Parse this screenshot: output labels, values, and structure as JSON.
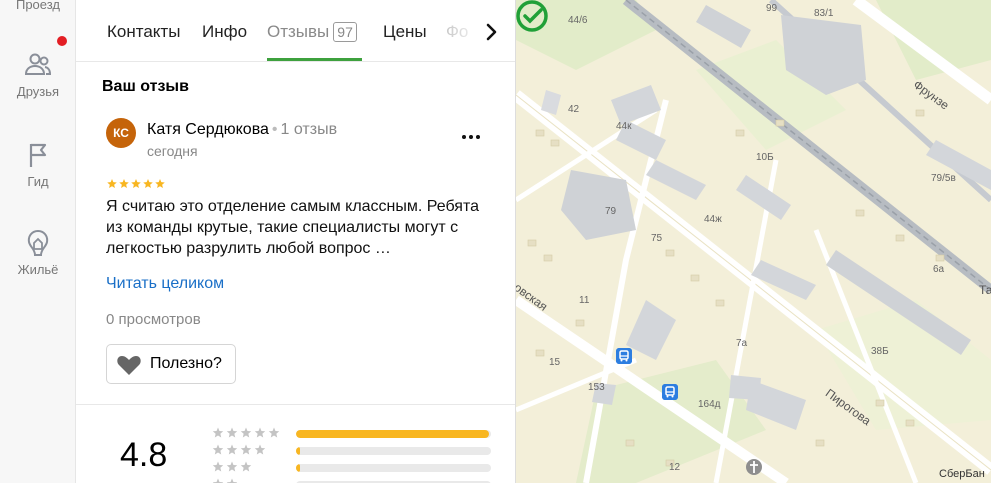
{
  "rail": {
    "items": [
      {
        "label": "Проезд",
        "icon": "route-icon"
      },
      {
        "label": "Друзья",
        "icon": "friends-icon",
        "has_notification": true
      },
      {
        "label": "Гид",
        "icon": "flag-icon"
      },
      {
        "label": "Жильё",
        "icon": "house-icon"
      }
    ]
  },
  "tabs": {
    "items": [
      {
        "label": "Контакты"
      },
      {
        "label": "Инфо"
      },
      {
        "label": "Отзывы",
        "count": "97",
        "active": true
      },
      {
        "label": "Цены"
      },
      {
        "label": "Фо"
      }
    ]
  },
  "review": {
    "section_title": "Ваш отзыв",
    "avatar_initials": "КС",
    "author": "Катя Сердюкова",
    "separator": "•",
    "author_reviews": "1 отзыв",
    "date": "сегодня",
    "rating": 5,
    "text": "Я считаю это отделение самым классным. Ребята из команды крутые, такие специалисты могут с легкостью разрулить любой вопрос …",
    "read_more": "Читать целиком",
    "views": "0 просмотров",
    "useful_label": "Полезно?"
  },
  "summary": {
    "rating": "4.8",
    "distribution": [
      {
        "stars": 5,
        "fraction": 0.99
      },
      {
        "stars": 4,
        "fraction": 0.02
      },
      {
        "stars": 3,
        "fraction": 0.02
      },
      {
        "stars": 2,
        "fraction": 0.0
      }
    ]
  },
  "map": {
    "labels": [
      "44/6",
      "99",
      "83/1",
      "42",
      "44к",
      "10Б",
      "79/5в",
      "79",
      "75",
      "44ж",
      "6а",
      "11",
      "7а",
      "38Б",
      "15",
      "153",
      "164д",
      "12"
    ],
    "streets": [
      "Фрунзе",
      "Пирогова",
      "овская",
      "Та"
    ],
    "brand": "СберБан",
    "colors": {
      "base": "#f3efd9",
      "road": "#ffffff",
      "building": "#cfd2d6",
      "park": "#d6eac0",
      "rail": "#9aa0a8",
      "stop": "#2d7ee0",
      "brand": "#21a038"
    }
  }
}
